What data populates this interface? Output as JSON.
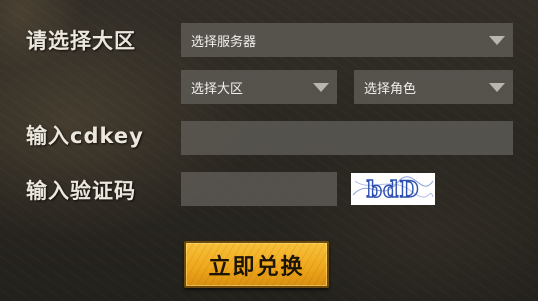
{
  "labels": {
    "region": "请选择大区",
    "cdkey": "输入cdkey",
    "captcha": "输入验证码"
  },
  "selects": {
    "server": "选择服务器",
    "region": "选择大区",
    "role": "选择角色"
  },
  "inputs": {
    "cdkey_value": "",
    "captcha_value": ""
  },
  "captcha_image": {
    "text": "bdD"
  },
  "redeem_button": "立即兑换",
  "colors": {
    "button_gold": "#f0a81c",
    "field_bg": "#5e5c56",
    "captcha_blue": "#2d4fb0"
  }
}
